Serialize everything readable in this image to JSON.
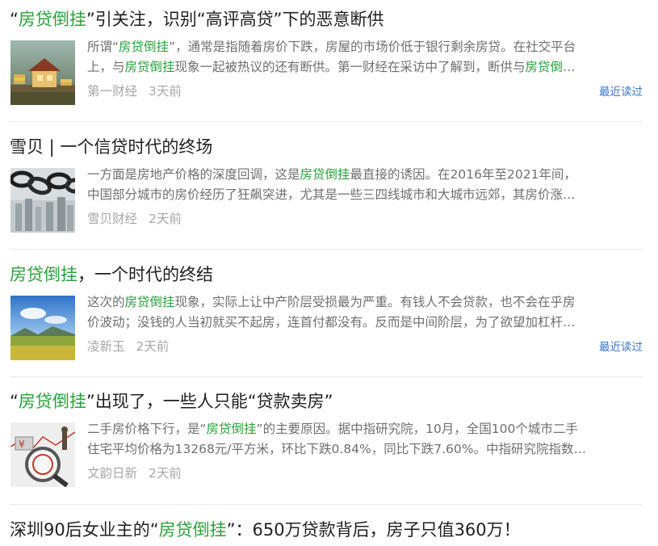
{
  "feed": {
    "articles": [
      {
        "title": [
          {
            "t": "“",
            "hl": false
          },
          {
            "t": "房贷倒挂",
            "hl": true
          },
          {
            "t": "”引关注，识别“高评高贷”下的恶意断供",
            "hl": false
          }
        ],
        "snippet": [
          [
            {
              "t": "所谓“",
              "hl": false
            },
            {
              "t": "房贷倒挂",
              "hl": true
            },
            {
              "t": "”，通常是指随着房价下跌，房屋的市场价低于银行剩余房贷。在社交平台",
              "hl": false
            }
          ],
          [
            {
              "t": "上，与",
              "hl": false
            },
            {
              "t": "房贷倒挂",
              "hl": true
            },
            {
              "t": "现象一起被热议的还有断供。第一财经在采访中了解到，断供与",
              "hl": false
            },
            {
              "t": "房贷倒",
              "hl": true
            },
            {
              "t": "…",
              "hl": false
            }
          ]
        ],
        "source": "第一财经",
        "time": "3天前",
        "recent": "最近读过",
        "thumb_icon": "house-coins-image"
      },
      {
        "title": [
          {
            "t": "雪贝 | 一个信贷时代的终场",
            "hl": false
          }
        ],
        "snippet": [
          [
            {
              "t": "一方面是房地产价格的深度回调，这是",
              "hl": false
            },
            {
              "t": "房贷倒挂",
              "hl": true
            },
            {
              "t": "最直接的诱因。在2016年至2021年间，",
              "hl": false
            }
          ],
          [
            {
              "t": "中国部分城市的房价经历了狂飙突进，尤其是一些三四线城市和大城市远郊，其房价涨…",
              "hl": false
            }
          ]
        ],
        "source": "雪贝财经",
        "time": "2天前",
        "recent": "",
        "thumb_icon": "chain-skyline-image"
      },
      {
        "title": [
          {
            "t": "房贷倒挂",
            "hl": true
          },
          {
            "t": "，一个时代的终结",
            "hl": false
          }
        ],
        "snippet": [
          [
            {
              "t": "这次的",
              "hl": false
            },
            {
              "t": "房贷倒挂",
              "hl": true
            },
            {
              "t": "现象，实际上让中产阶层受损最为严重。有钱人不会贷款，也不会在乎房",
              "hl": false
            }
          ],
          [
            {
              "t": "价波动；没钱的人当初就买不起房，连首付都没有。反而是中间阶层，为了欲望加杠杆…",
              "hl": false
            }
          ]
        ],
        "source": "凌新玉",
        "time": "2天前",
        "recent": "最近读过",
        "thumb_icon": "landscape-image"
      },
      {
        "title": [
          {
            "t": "“",
            "hl": false
          },
          {
            "t": "房贷倒挂",
            "hl": true
          },
          {
            "t": "”出现了，一些人只能“贷款卖房”",
            "hl": false
          }
        ],
        "snippet": [
          [
            {
              "t": "二手房价格下行，是“",
              "hl": false
            },
            {
              "t": "房贷倒挂",
              "hl": true
            },
            {
              "t": "”的主要原因。据中指研究院，10月，全国100个城市二手",
              "hl": false
            }
          ],
          [
            {
              "t": "住宅平均价格为13268元/平方米，环比下跌0.84%，同比下跌7.60%。中指研究院指数…",
              "hl": false
            }
          ]
        ],
        "source": "文韵日新",
        "time": "2天前",
        "recent": "",
        "thumb_icon": "house-loan-magnifier-image"
      },
      {
        "title": [
          {
            "t": "深圳90后女业主的“",
            "hl": false
          },
          {
            "t": "房贷倒挂",
            "hl": true
          },
          {
            "t": "”：650万贷款背后，房子只值360万！",
            "hl": false
          }
        ]
      }
    ]
  }
}
